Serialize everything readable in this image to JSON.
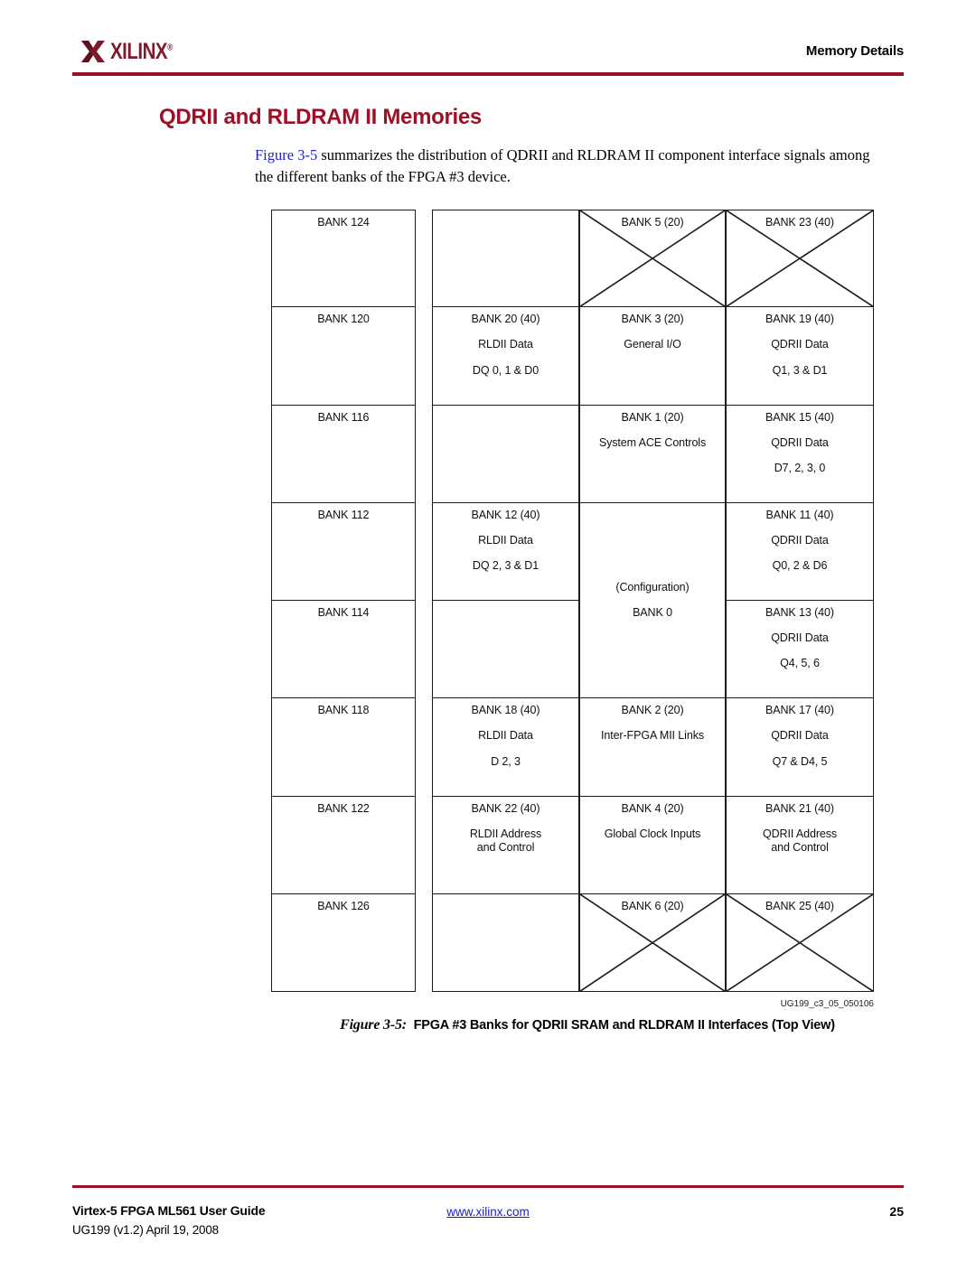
{
  "header": {
    "logo_text": "XILINX",
    "logo_registered": "®",
    "title": "Memory Details",
    "rule_color": "#9c1127"
  },
  "section": {
    "title": "QDRII and RLDRAM II Memories",
    "intro_ref": "Figure 3-5",
    "intro_rest": " summarizes the distribution of QDRII and RLDRAM II component interface signals among the different banks of the FPGA #3 device."
  },
  "figure": {
    "id_label": "UG199_c3_05_050106",
    "caption_number": "Figure 3-5:",
    "caption_text": "FPGA #3 Banks for QDRII SRAM and RLDRAM II Interfaces (Top View)",
    "columns": [
      {
        "name": "column-left-banks",
        "cells": [
          {
            "lines": [
              "BANK 124"
            ],
            "crossed": false
          },
          {
            "lines": [
              "BANK 120"
            ],
            "crossed": false
          },
          {
            "lines": [
              "BANK 116"
            ],
            "crossed": false
          },
          {
            "lines": [
              "BANK 112"
            ],
            "crossed": false
          },
          {
            "lines": [
              "BANK 114"
            ],
            "crossed": false
          },
          {
            "lines": [
              "BANK 118"
            ],
            "crossed": false
          },
          {
            "lines": [
              "BANK 122"
            ],
            "crossed": false
          },
          {
            "lines": [
              "BANK 126"
            ],
            "crossed": false
          }
        ]
      },
      {
        "name": "column-rldii-banks",
        "cells": [
          {
            "lines": [],
            "crossed": false
          },
          {
            "lines": [
              "BANK 20 (40)",
              "RLDII Data",
              "DQ 0, 1 & D0"
            ],
            "crossed": false
          },
          {
            "lines": [],
            "crossed": false
          },
          {
            "lines": [
              "BANK 12 (40)",
              "RLDII Data",
              "DQ 2, 3 & D1"
            ],
            "crossed": false
          },
          {
            "lines": [],
            "crossed": false
          },
          {
            "lines": [
              "BANK 18 (40)",
              "RLDII Data",
              "D 2, 3"
            ],
            "crossed": false
          },
          {
            "lines": [
              "BANK 22 (40)",
              "RLDII Address",
              "and Control"
            ],
            "crossed": false
          },
          {
            "lines": [],
            "crossed": false
          }
        ]
      },
      {
        "name": "column-general-banks",
        "cells": [
          {
            "lines": [
              "BANK 5 (20)"
            ],
            "crossed": true
          },
          {
            "lines": [
              "BANK 3 (20)",
              "General I/O"
            ],
            "crossed": false
          },
          {
            "lines": [
              "BANK 1 (20)",
              "System ACE Controls"
            ],
            "crossed": false
          },
          {
            "lines": [
              "(Configuration)",
              "BANK 0"
            ],
            "crossed": false,
            "tall": true
          },
          {
            "lines": [
              "BANK 2 (20)",
              "Inter-FPGA MII Links"
            ],
            "crossed": false
          },
          {
            "lines": [
              "BANK 4 (20)",
              "Global Clock Inputs"
            ],
            "crossed": false
          },
          {
            "lines": [
              "BANK 6 (20)"
            ],
            "crossed": true
          }
        ]
      },
      {
        "name": "column-qdrii-banks",
        "cells": [
          {
            "lines": [
              "BANK 23 (40)"
            ],
            "crossed": true
          },
          {
            "lines": [
              "BANK 19 (40)",
              "QDRII Data",
              "Q1, 3 & D1"
            ],
            "crossed": false
          },
          {
            "lines": [
              "BANK 15 (40)",
              "QDRII Data",
              "D7, 2, 3, 0"
            ],
            "crossed": false
          },
          {
            "lines": [
              "BANK 11 (40)",
              "QDRII Data",
              "Q0, 2 & D6"
            ],
            "crossed": false
          },
          {
            "lines": [
              "BANK 13 (40)",
              "QDRII Data",
              "Q4, 5, 6"
            ],
            "crossed": false
          },
          {
            "lines": [
              "BANK 17 (40)",
              "QDRII Data",
              "Q7 & D4, 5"
            ],
            "crossed": false
          },
          {
            "lines": [
              "BANK 21 (40)",
              "QDRII Address",
              "and Control"
            ],
            "crossed": false
          },
          {
            "lines": [
              "BANK 25 (40)"
            ],
            "crossed": true
          }
        ]
      }
    ]
  },
  "footer": {
    "guide": "Virtex-5 FPGA ML561 User Guide",
    "doc_id": "UG199 (v1.2) April 19, 2008",
    "url": "www.xilinx.com",
    "page_number": "25"
  }
}
